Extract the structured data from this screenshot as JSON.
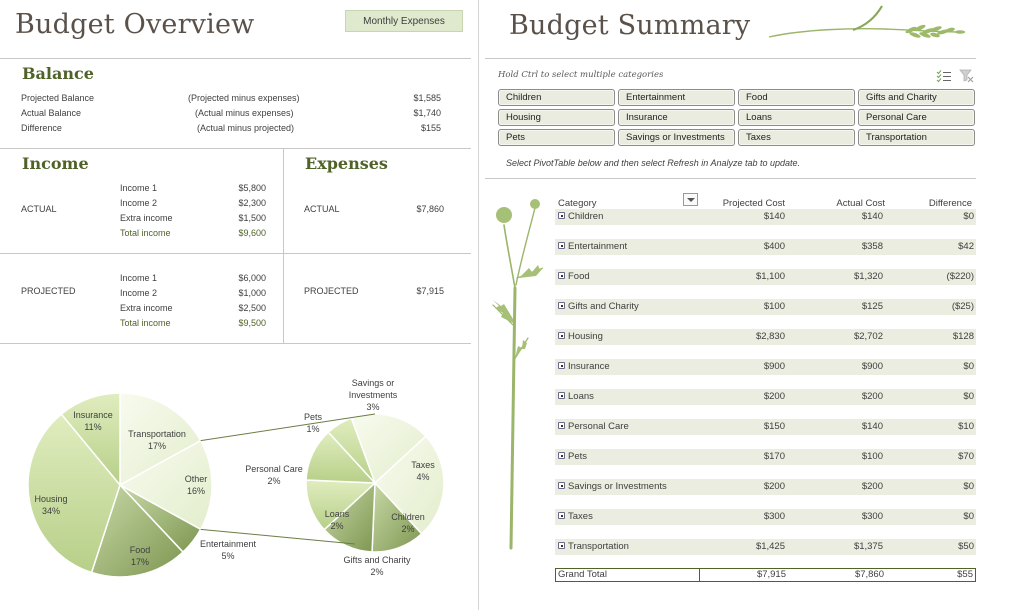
{
  "overview": {
    "title": "Budget Overview",
    "monthly_expenses_button": "Monthly Expenses",
    "balance": {
      "title": "Balance",
      "rows": [
        {
          "label": "Projected Balance",
          "note": "(Projected  minus expenses)",
          "value": "$1,585"
        },
        {
          "label": "Actual Balance",
          "note": "(Actual  minus expenses)",
          "value": "$1,740"
        },
        {
          "label": "Difference",
          "note": "(Actual minus projected)",
          "value": "$155"
        }
      ]
    },
    "income": {
      "title": "Income",
      "actual": {
        "label": "ACTUAL",
        "items": [
          {
            "label": "Income 1",
            "value": "$5,800"
          },
          {
            "label": "Income 2",
            "value": "$2,300"
          },
          {
            "label": "Extra income",
            "value": "$1,500"
          },
          {
            "label": "Total income",
            "value": "$9,600"
          }
        ]
      },
      "projected": {
        "label": "PROJECTED",
        "items": [
          {
            "label": "Income 1",
            "value": "$6,000"
          },
          {
            "label": "Income 2",
            "value": "$1,000"
          },
          {
            "label": "Extra income",
            "value": "$2,500"
          },
          {
            "label": "Total income",
            "value": "$9,500"
          }
        ]
      }
    },
    "expenses": {
      "title": "Expenses",
      "actual": {
        "label": "ACTUAL",
        "value": "$7,860"
      },
      "projected": {
        "label": "PROJECTED",
        "value": "$7,915"
      }
    }
  },
  "chart_data": {
    "type": "pie",
    "subtype": "pie-of-pie",
    "title": "",
    "colors": {
      "light": "#f3f8e6",
      "mid": "#d2e4aa",
      "dark": "#8aa25a",
      "line": "#6b7d45"
    },
    "main": {
      "slices": [
        {
          "label": "Transportation",
          "percent": 17
        },
        {
          "label": "Other",
          "percent": 16
        },
        {
          "label": "Entertainment",
          "percent": 5
        },
        {
          "label": "Food",
          "percent": 17
        },
        {
          "label": "Housing",
          "percent": 34
        },
        {
          "label": "Insurance",
          "percent": 11
        }
      ]
    },
    "secondary": {
      "slices": [
        {
          "label": "Savings or Investments",
          "percent": 3
        },
        {
          "label": "Taxes",
          "percent": 4
        },
        {
          "label": "Children",
          "percent": 2
        },
        {
          "label": "Gifts and Charity",
          "percent": 2
        },
        {
          "label": "Loans",
          "percent": 2
        },
        {
          "label": "Personal Care",
          "percent": 2
        },
        {
          "label": "Pets",
          "percent": 1
        }
      ]
    },
    "labels": {
      "Insurance": [
        "Insurance",
        "11%"
      ],
      "Transportation": [
        "Transportation",
        "17%"
      ],
      "Other": [
        "Other",
        "16%"
      ],
      "Housing": [
        "Housing",
        "34%"
      ],
      "Food": [
        "Food",
        "17%"
      ],
      "Entertainment": [
        "Entertainment",
        "5%"
      ],
      "Savings or Investments": [
        "Savings or",
        "Investments",
        "3%"
      ],
      "Pets": [
        "Pets",
        "1%"
      ],
      "Personal Care": [
        "Personal Care",
        "2%"
      ],
      "Taxes": [
        "Taxes",
        "4%"
      ],
      "Loans": [
        "Loans",
        "2%"
      ],
      "Children": [
        "Children",
        "2%"
      ],
      "Gifts and Charity": [
        "Gifts and Charity",
        "2%"
      ]
    }
  },
  "summary": {
    "title": "Budget Summary",
    "slicer": {
      "hint": "Hold Ctrl to select multiple categories",
      "multiselect_icon": "multi-select-icon",
      "clear_filter_icon": "clear-filter-icon",
      "items": [
        "Children",
        "Entertainment",
        "Food",
        "Gifts and Charity",
        "Housing",
        "Insurance",
        "Loans",
        "Personal Care",
        "Pets",
        "Savings or Investments",
        "Taxes",
        "Transportation"
      ]
    },
    "refresh_note_parts": [
      "Select PivotTable below and then select ",
      "Refresh",
      " in Analyze tab to update."
    ],
    "pivot": {
      "headers": {
        "category": "Category",
        "projected": "Projected Cost",
        "actual": "Actual Cost",
        "difference": "Difference"
      },
      "rows": [
        {
          "category": "Children",
          "projected": "$140",
          "actual": "$140",
          "difference": "$0"
        },
        {
          "category": "Entertainment",
          "projected": "$400",
          "actual": "$358",
          "difference": "$42"
        },
        {
          "category": "Food",
          "projected": "$1,100",
          "actual": "$1,320",
          "difference": "($220)"
        },
        {
          "category": "Gifts and Charity",
          "projected": "$100",
          "actual": "$125",
          "difference": "($25)"
        },
        {
          "category": "Housing",
          "projected": "$2,830",
          "actual": "$2,702",
          "difference": "$128"
        },
        {
          "category": "Insurance",
          "projected": "$900",
          "actual": "$900",
          "difference": "$0"
        },
        {
          "category": "Loans",
          "projected": "$200",
          "actual": "$200",
          "difference": "$0"
        },
        {
          "category": "Personal Care",
          "projected": "$150",
          "actual": "$140",
          "difference": "$10"
        },
        {
          "category": "Pets",
          "projected": "$170",
          "actual": "$100",
          "difference": "$70"
        },
        {
          "category": "Savings or Investments",
          "projected": "$200",
          "actual": "$200",
          "difference": "$0"
        },
        {
          "category": "Taxes",
          "projected": "$300",
          "actual": "$300",
          "difference": "$0"
        },
        {
          "category": "Transportation",
          "projected": "$1,425",
          "actual": "$1,375",
          "difference": "$50"
        }
      ],
      "grand_total": {
        "label": "Grand Total",
        "projected": "$7,915",
        "actual": "$7,860",
        "difference": "$55"
      }
    }
  }
}
